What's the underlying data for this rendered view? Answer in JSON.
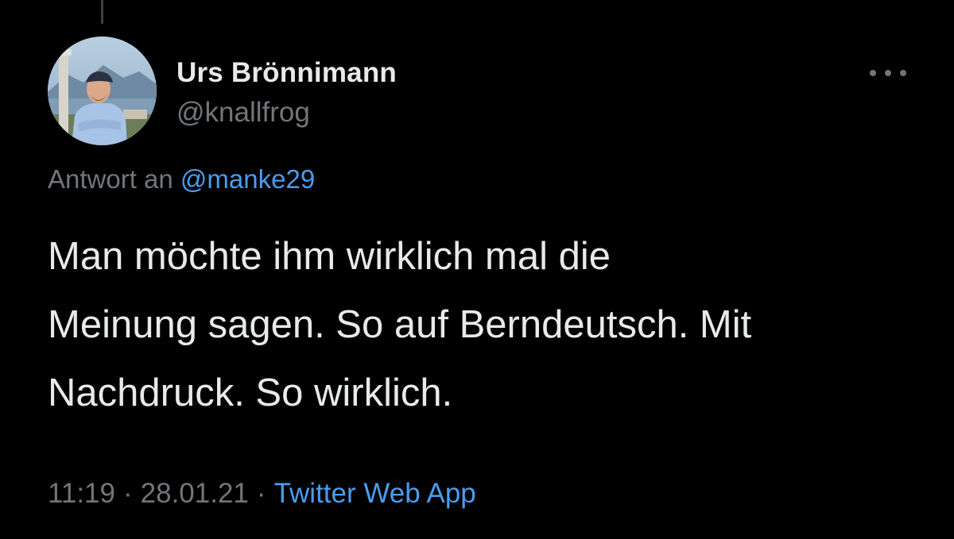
{
  "colors": {
    "background": "#000000",
    "primary_text": "#e7e9ea",
    "secondary_text": "#71767b",
    "link": "#4a9cef"
  },
  "author": {
    "display_name": "Urs Brönnimann",
    "handle": "@knallfrog",
    "avatar_icon": "profile-photo"
  },
  "more_icon": "more-horizontal-icon",
  "reply": {
    "prefix": "Antwort an",
    "mention": "@manke29"
  },
  "tweet": {
    "lines": [
      "Man möchte ihm wirklich mal die",
      "Meinung sagen. So auf Berndeutsch. Mit",
      "Nachdruck. So wirklich."
    ]
  },
  "meta": {
    "time": "11:19",
    "date": "28.01.21",
    "separator": "·",
    "source": "Twitter Web App"
  }
}
